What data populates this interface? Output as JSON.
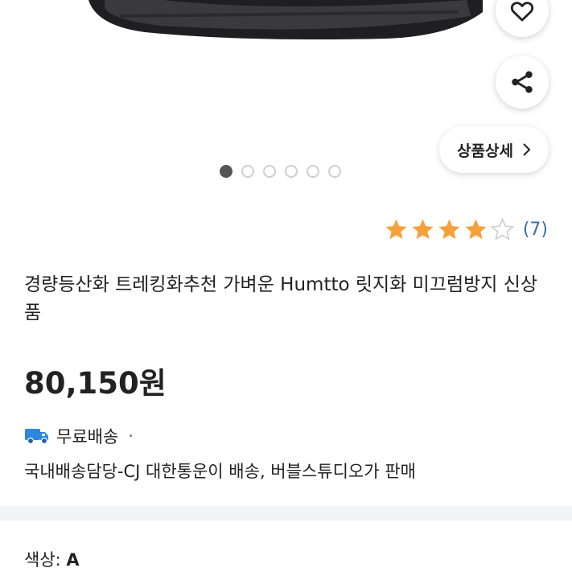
{
  "hero": {
    "image_alt": "shoe-image",
    "icons": {
      "wish": "heart-icon",
      "share": "share-icon"
    },
    "detail_button_label": "상품상세",
    "carousel": {
      "total": 6,
      "active": 1
    }
  },
  "rating": {
    "stars": 4,
    "max_stars": 5,
    "count_text": "(7)",
    "star_color": "#F5A03A"
  },
  "product": {
    "title": "경량등산화 트레킹화추천 가벼운 Humtto 릿지화 미끄럼방지 신상품",
    "price": "80,150원"
  },
  "shipping": {
    "icon": "truck-icon",
    "label": "무료배송",
    "separator": "·",
    "description": "국내배송담당-CJ 대한통운이 배송, 버블스튜디오가 판매"
  },
  "option": {
    "label": "색상:",
    "value": "A"
  },
  "colors": {
    "accent_link": "#3A6EA5",
    "truck": "#2E86DE",
    "divider": "#F2F3F5"
  }
}
